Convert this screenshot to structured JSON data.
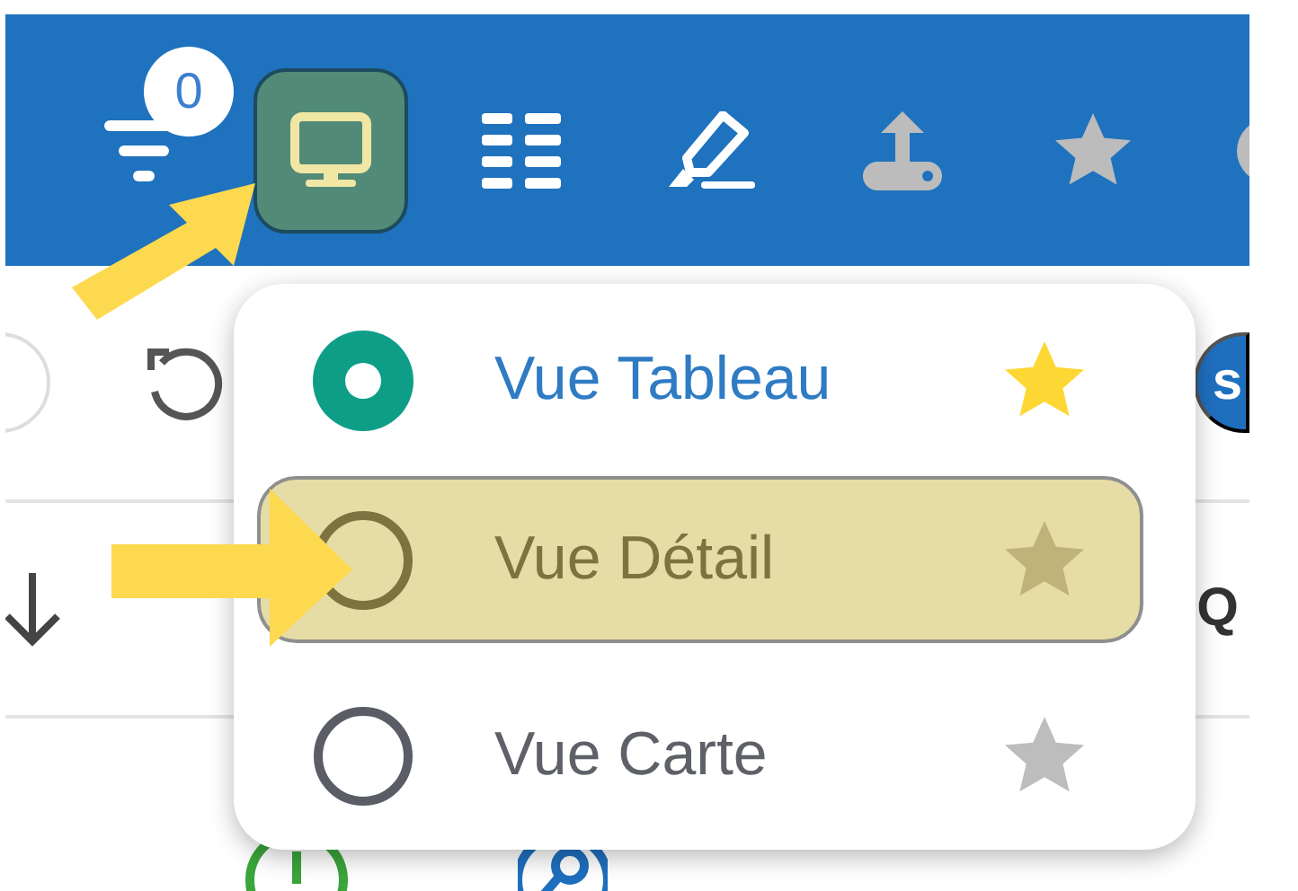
{
  "toolbar": {
    "items": [
      {
        "kind": "filter",
        "badge": "0",
        "selected": false,
        "disabled": false
      },
      {
        "kind": "monitor",
        "selected": true,
        "disabled": false
      },
      {
        "kind": "list",
        "selected": false,
        "disabled": false
      },
      {
        "kind": "highlighter",
        "selected": false,
        "disabled": false
      },
      {
        "kind": "upload",
        "selected": false,
        "disabled": true
      },
      {
        "kind": "star",
        "selected": false,
        "disabled": true
      },
      {
        "kind": "circle",
        "selected": false,
        "disabled": true
      }
    ]
  },
  "background": {
    "button_text": "s",
    "column_header": "Q"
  },
  "view_menu": {
    "items": [
      {
        "label": "Vue Tableau",
        "selected": true,
        "highlighted": false,
        "favorite": true
      },
      {
        "label": "Vue Détail",
        "selected": false,
        "highlighted": true,
        "favorite": false
      },
      {
        "label": "Vue Carte",
        "selected": false,
        "highlighted": false,
        "favorite": false
      }
    ]
  }
}
